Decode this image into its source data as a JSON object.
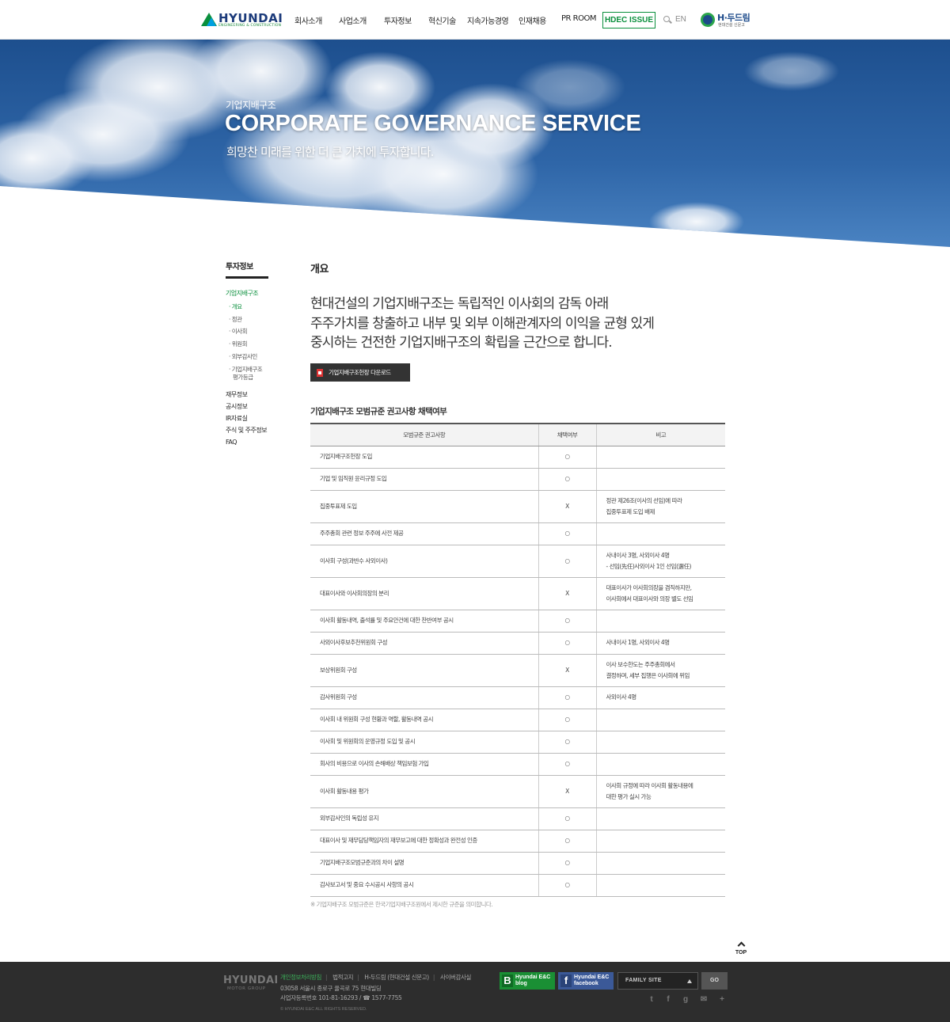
{
  "header": {
    "logo_text": "HYUNDAI",
    "logo_sub": "ENGINEERING & CONSTRUCTION",
    "nav": [
      "회사소개",
      "사업소개",
      "투자정보",
      "혁신기술",
      "지속가능경영",
      "인재채용",
      "PR ROOM"
    ],
    "hdec_issue": "HDEC ISSUE",
    "lang": "EN",
    "hdream_title": "H·두드림",
    "hdream_sub": "현대건설 신문고"
  },
  "hero": {
    "category": "기업지배구조",
    "title": "CORPORATE GOVERNANCE SERVICE",
    "subtitle": "희망찬 미래를 위한 더 큰 가치에 투자합니다."
  },
  "sidebar": {
    "title": "투자정보",
    "active_section": "기업지배구조",
    "sub_items": [
      "· 개요",
      "· 정관",
      "· 이사회",
      "· 위원회",
      "· 외부감사인",
      "· 기업지배구조",
      "평가등급"
    ],
    "items": [
      "재무정보",
      "공시정보",
      "IR자료실",
      "주식 및 주주정보",
      "FAQ"
    ]
  },
  "content": {
    "title": "개요",
    "lead_lines": [
      "현대건설의 기업지배구조는 독립적인 이사회의 감독 아래",
      "주주가치를 창출하고 내부 및 외부 이해관계자의 이익을 균형 있게",
      "중시하는 건전한 기업지배구조의 확립을 근간으로 합니다."
    ],
    "download_label": "기업지배구조헌장 다운로드",
    "section_title": "기업지배구조 모범규준 권고사항 채택여부",
    "table": {
      "headers": [
        "모범규준 권고사항",
        "채택여부",
        "비고"
      ],
      "rows": [
        {
          "item": "기업지배구조헌장 도입",
          "adopted": "○",
          "note": [
            "",
            ""
          ]
        },
        {
          "item": "기업 및 임직원 윤리규정 도입",
          "adopted": "○",
          "note": [
            "",
            ""
          ]
        },
        {
          "item": "집중투표제 도입",
          "adopted": "X",
          "note": [
            "정관 제26조(이사의 선임)에 따라",
            "집중투표제 도입 배제"
          ]
        },
        {
          "item": "주주총회 관련 정보 주주에 사전 제공",
          "adopted": "○",
          "note": [
            "",
            ""
          ]
        },
        {
          "item": "이사회 구성(과반수 사외이사)",
          "adopted": "○",
          "note": [
            "사내이사 3명, 사외이사 4명",
            "- 선임(先任)사외이사 1인 선임(選任)"
          ]
        },
        {
          "item": "대표이사와 이사회의장의 분리",
          "adopted": "X",
          "note": [
            "대표이사가 이사회의장을 겸직하지만,",
            "이사회에서 대표이사와 의장 별도 선임"
          ]
        },
        {
          "item": "이사회 활동내역, 출석률 및 주요안건에 대한 찬반여부 공시",
          "adopted": "○",
          "note": [
            "",
            ""
          ]
        },
        {
          "item": "사외이사후보추천위원회 구성",
          "adopted": "○",
          "note": [
            "사내이사 1명, 사외이사 4명",
            ""
          ]
        },
        {
          "item": "보상위원회 구성",
          "adopted": "X",
          "note": [
            "이사 보수한도는 주주총회에서",
            "결정하며, 세부 집행은 이사회에 위임"
          ]
        },
        {
          "item": "감사위원회 구성",
          "adopted": "○",
          "note": [
            "사외이사 4명",
            ""
          ]
        },
        {
          "item": "이사회 내 위원회 구성 현황과 역할, 활동내역 공시",
          "adopted": "○",
          "note": [
            "",
            ""
          ]
        },
        {
          "item": "이사회 및 위원회의 운영규정 도입 및 공시",
          "adopted": "○",
          "note": [
            "",
            ""
          ]
        },
        {
          "item": "회사의 비용으로 이사의 손해배상 책임보험 가입",
          "adopted": "○",
          "note": [
            "",
            ""
          ]
        },
        {
          "item": "이사회 활동내용 평가",
          "adopted": "X",
          "note": [
            "이사회 규정에 따라 이사회 활동내용에",
            "대한 평가 실시 가능"
          ]
        },
        {
          "item": "외부감사인의 독립성 유지",
          "adopted": "○",
          "note": [
            "",
            ""
          ]
        },
        {
          "item": "대표이사 및 재무담당책임자의 재무보고에 대한 정확성과 완전성 인증",
          "adopted": "○",
          "note": [
            "",
            ""
          ]
        },
        {
          "item": "기업지배구조모범규준과의 차이 설명",
          "adopted": "○",
          "note": [
            "",
            ""
          ]
        },
        {
          "item": "감사보고서 및 중요 수시공시 사항의 공시",
          "adopted": "○",
          "note": [
            "",
            ""
          ]
        }
      ]
    },
    "footnote": "※ 기업지배구조 모범규준은 한국기업지배구조원에서 제시한 규준을 의미합니다."
  },
  "top_label": "TOP",
  "footer": {
    "logo": "HYUNDAI",
    "logo_sub": "MOTOR GROUP",
    "links": [
      "개인정보처리방침",
      "법적고지",
      "H-두드림 (현대건설 신문고)",
      "사이버감사실"
    ],
    "address": "03058 서울시 종로구 율곡로 75 현대빌딩",
    "biz_no": "사업자등록번호 101-81-16293 / ☎ 1577-7755",
    "copyright": "© HYUNDAI E&C ALL RIGHTS RESERVED.",
    "blog_line1": "Hyundai E&C",
    "blog_line2": "blog",
    "fb_line1": "Hyundai E&C",
    "fb_line2": "facebook",
    "family_site": "FAMILY SITE",
    "go": "GO"
  },
  "colors": {
    "brand_green": "#0a8f3c",
    "brand_blue": "#1b3a7a",
    "footer_bg": "#2d2d2d"
  }
}
